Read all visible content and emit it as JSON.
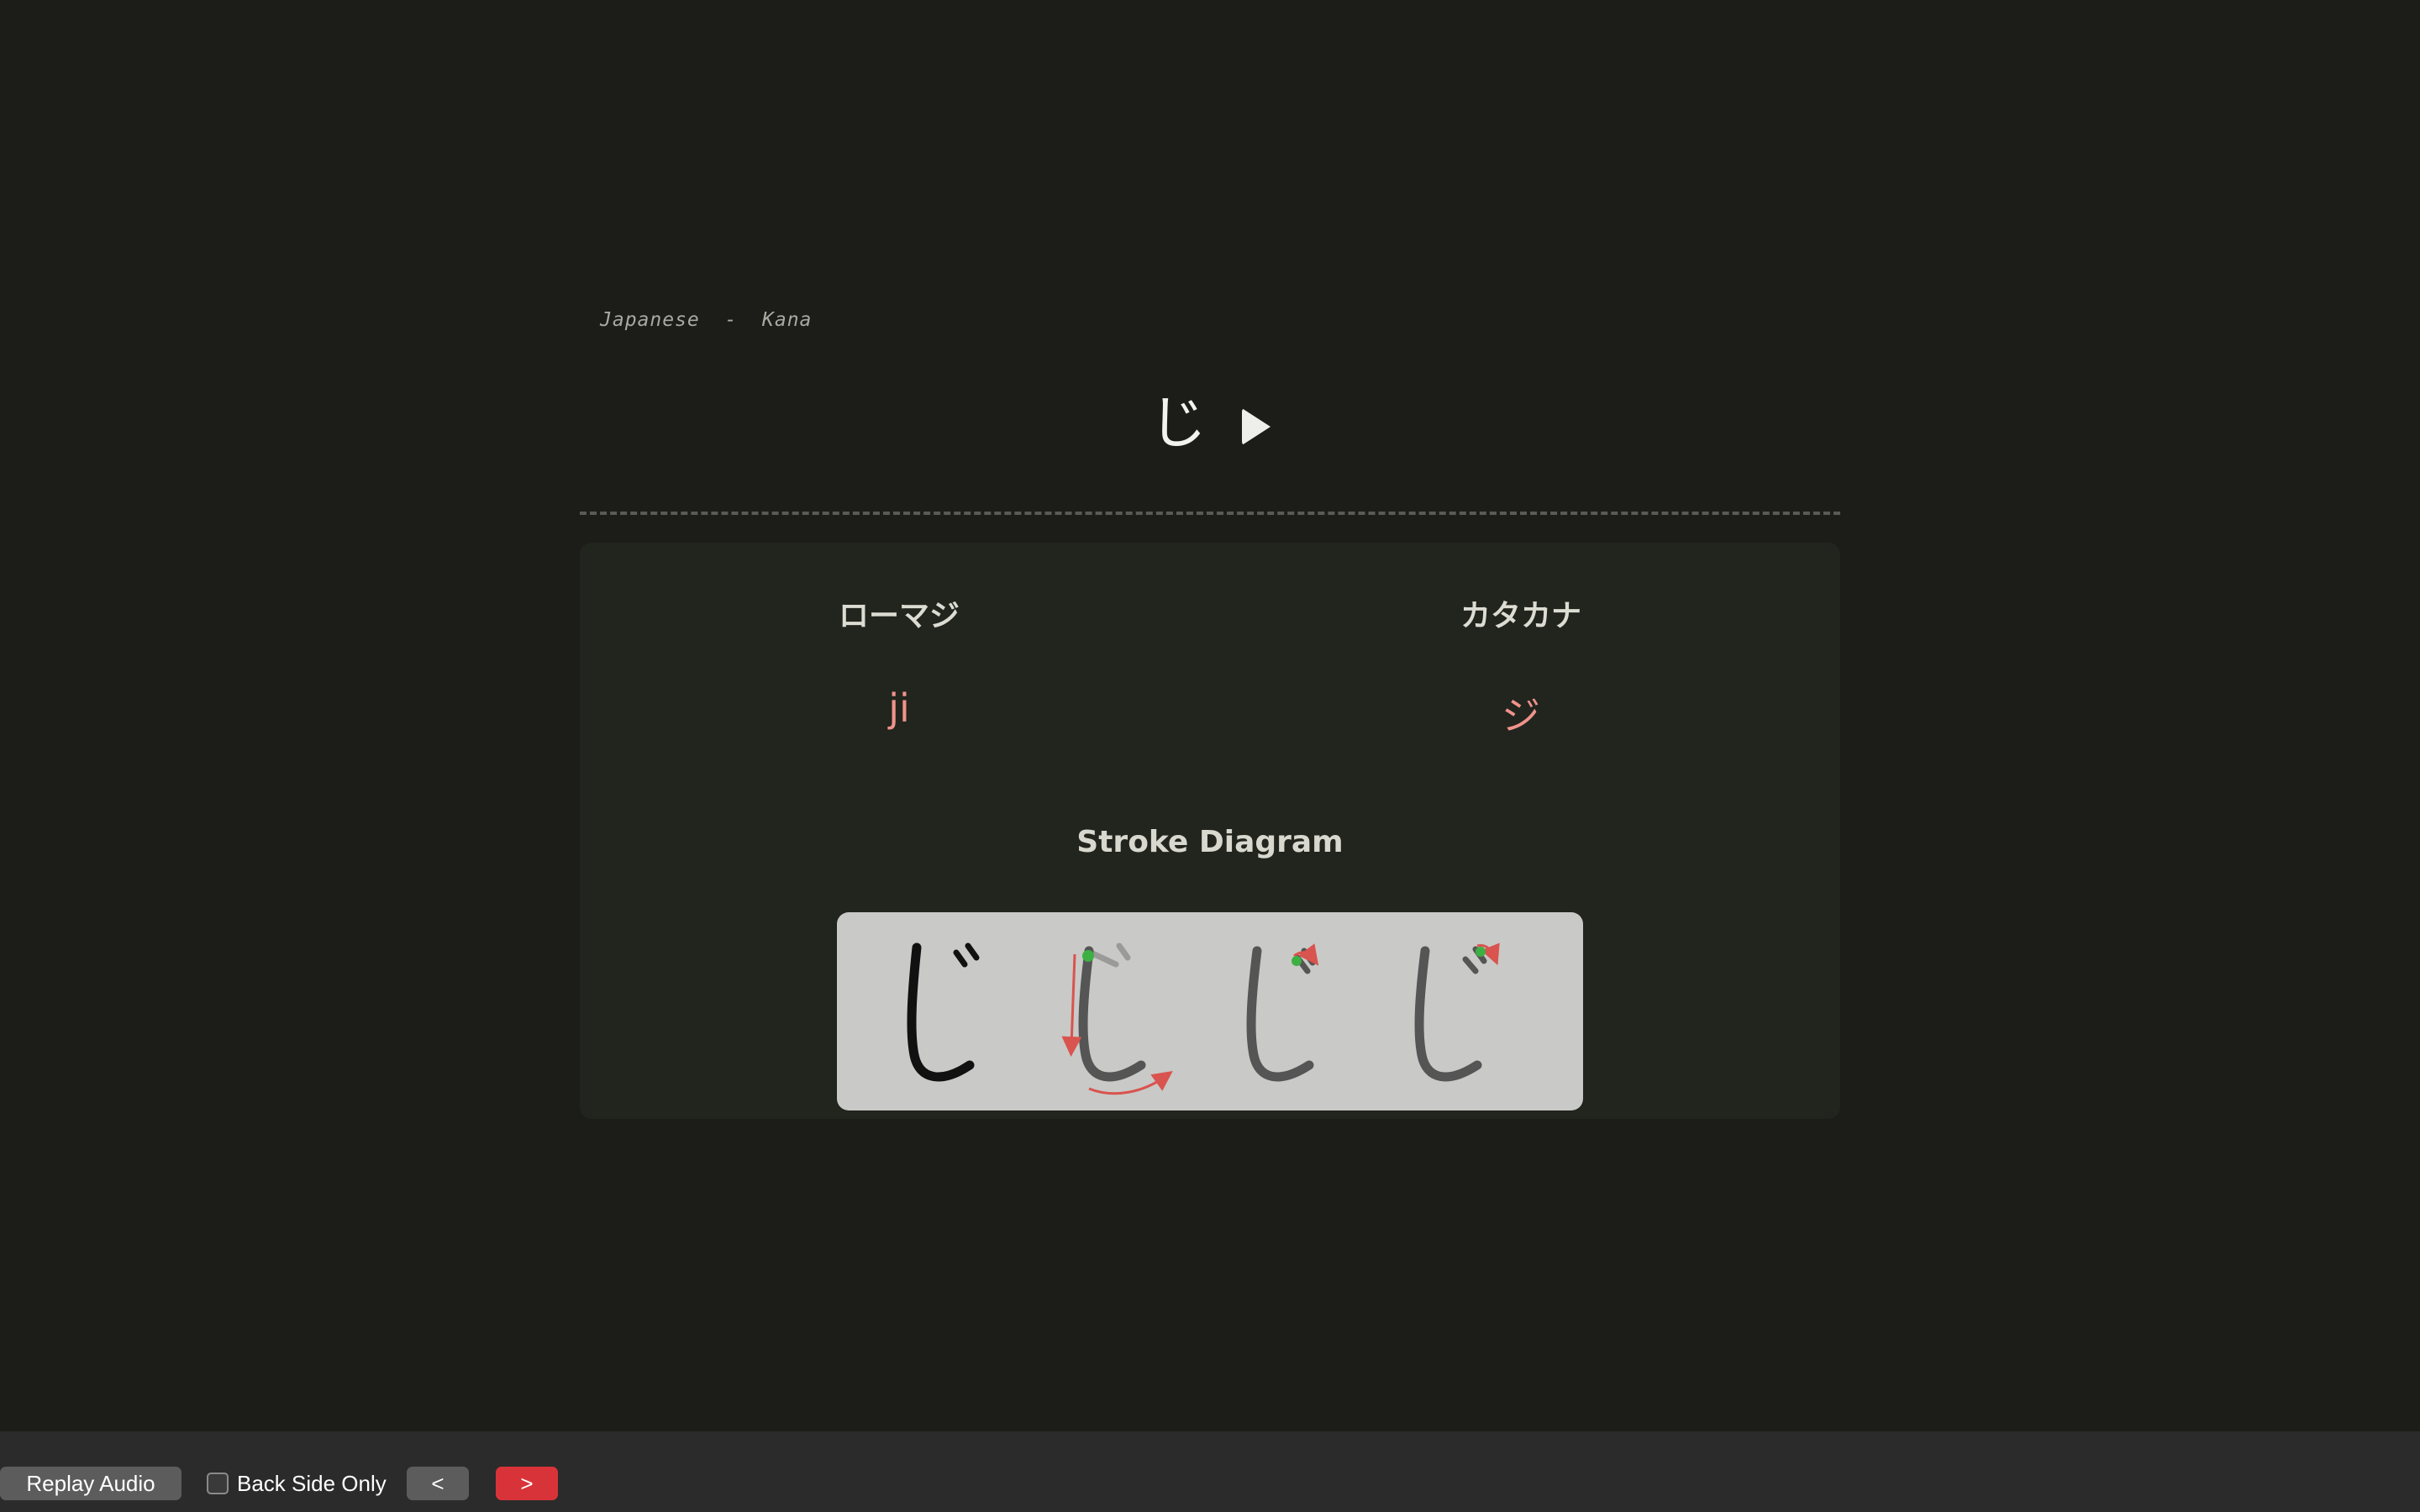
{
  "card": {
    "deck_label": "Japanese  -  Kana",
    "front_character": "じ",
    "play_icon": "play-icon"
  },
  "back": {
    "romaji_header": "ローマジ",
    "romaji_value": "ji",
    "katakana_header": "カタカナ",
    "katakana_value": "ジ",
    "stroke_diagram_title": "Stroke Diagram",
    "stroke_diagram_frames": 4
  },
  "toolbar": {
    "replay_audio_label": "Replay Audio",
    "back_side_only_label": "Back Side Only",
    "back_side_only_checked": false,
    "prev_label": "<",
    "next_label": ">"
  },
  "colors": {
    "background": "#1c1c19",
    "panel": "#22241e",
    "accent_value": "#ef938b",
    "next_button": "#d9333a",
    "stroke_arrow": "#d9534f",
    "stroke_start": "#3cb043"
  }
}
